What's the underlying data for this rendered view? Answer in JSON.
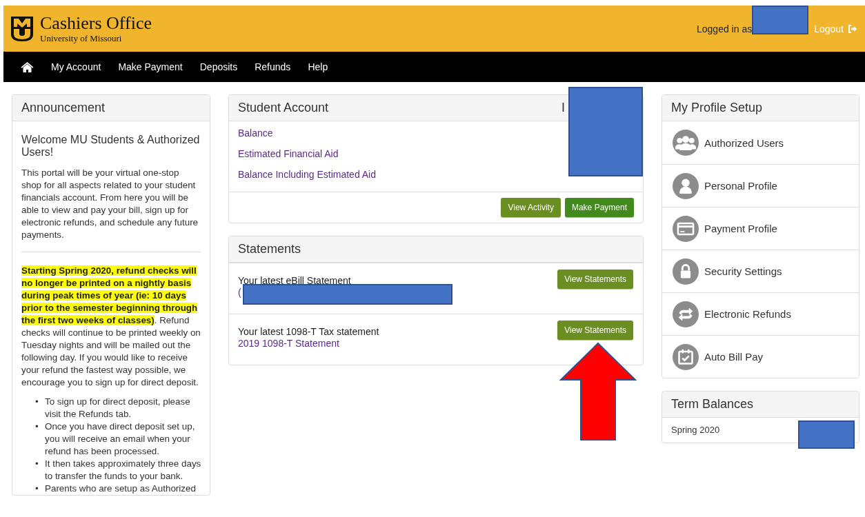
{
  "header": {
    "logo_title": "Cashiers Office",
    "logo_subtitle": "University of Missouri",
    "logged_in_label": "Logged in as",
    "logout": "Logout"
  },
  "nav": {
    "items": [
      {
        "label": "My Account"
      },
      {
        "label": "Make Payment"
      },
      {
        "label": "Deposits"
      },
      {
        "label": "Refunds"
      },
      {
        "label": "Help"
      }
    ]
  },
  "announcement": {
    "title": "Announcement",
    "welcome": "Welcome MU Students & Authorized Users!",
    "intro": "This portal will be your virtual one-stop shop for all aspects related to your student financials account. From here you will be able to view and pay your bill, sign up for electronic refunds, and schedule any future payments.",
    "notice": "**Starting Spring 2020, refund checks will no longer be printed on a nightly basis during peak times of year (ie: 10 days prior to the semester beginning through the first two weeks of classes)**.  Refund checks will continue to be printed weekly on Tuesday nights and will be mailed out the following day. If you would like to receive your refund the fastest way possible, we encourage you to sign up for direct deposit.",
    "bullets": [
      {
        "marker": "•",
        "text": "To sign up for direct deposit, please visit the Refunds tab."
      },
      {
        "marker": "•",
        "text": "Once you have direct deposit set up, you will receive an email when your refund has been processed."
      },
      {
        "marker": "•",
        "text": "It then takes approximately three days to transfer the funds to your bank."
      },
      {
        "marker": "•",
        "text": "Parents who are setup as Authorized"
      }
    ]
  },
  "student_account": {
    "title": "Student Account",
    "header_fragment": "I",
    "rows": [
      {
        "label": "Balance"
      },
      {
        "label": "Estimated Financial Aid"
      },
      {
        "label": "Balance Including Estimated Aid"
      }
    ],
    "buttons": [
      {
        "label": "View Activity",
        "kind": "secondary"
      },
      {
        "label": "Make Payment",
        "kind": "primary"
      }
    ]
  },
  "statements": {
    "title": "Statements",
    "items": [
      {
        "text": "Your latest eBill Statement",
        "link": "(",
        "button": "View Statements"
      },
      {
        "text": "Your latest 1098-T Tax statement",
        "link": "2019 1098-T Statement",
        "button": "View Statements"
      }
    ]
  },
  "profile_setup": {
    "title": "My Profile Setup",
    "items": [
      {
        "label": "Authorized Users",
        "kind": "users"
      },
      {
        "label": "Personal Profile",
        "kind": "user"
      },
      {
        "label": "Payment Profile",
        "kind": "card"
      },
      {
        "label": "Security Settings",
        "kind": "lock"
      },
      {
        "label": "Electronic Refunds",
        "kind": "exchange"
      },
      {
        "label": "Auto Bill Pay",
        "kind": "calendar"
      }
    ]
  },
  "term_balances": {
    "title": "Term Balances",
    "rows": [
      {
        "term": "Spring 2020"
      }
    ]
  }
}
